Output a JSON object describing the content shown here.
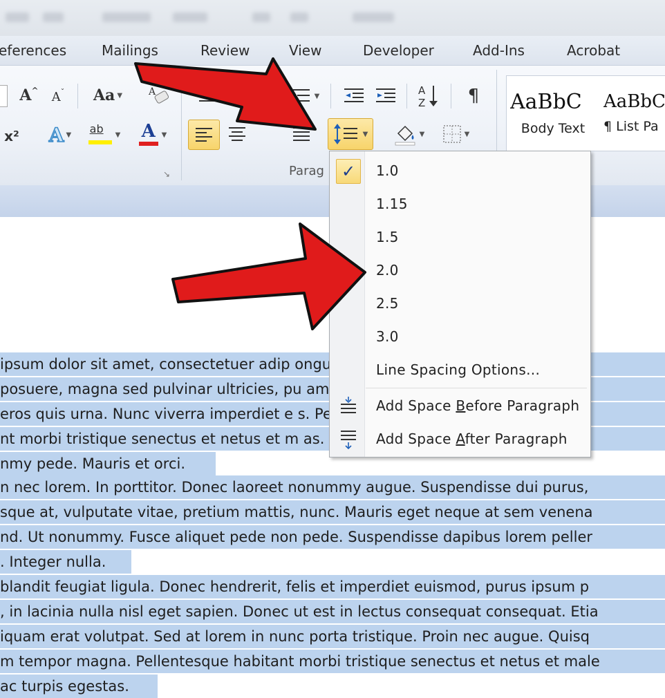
{
  "tabs": [
    "eferences",
    "Mailings",
    "Review",
    "View",
    "Developer",
    "Add-Ins",
    "Acrobat"
  ],
  "ribbon": {
    "font_group": {
      "grow_font": "A",
      "shrink_font": "A",
      "change_case": "Aa",
      "superscript": "x²",
      "text_effects": "A",
      "highlight": "ab",
      "font_color": "A"
    },
    "paragraph_label": "Parag",
    "pilcrow": "¶",
    "sort": "A↓Z",
    "styles": [
      {
        "sample": "AaBbC",
        "name": "Body Text"
      },
      {
        "sample": "AaBbC",
        "name": "¶ List Pa"
      }
    ]
  },
  "menu": {
    "check_mark": "✓",
    "items": [
      {
        "label": "1.0",
        "checked": true
      },
      {
        "label": "1.15"
      },
      {
        "label": "1.5"
      },
      {
        "label": "2.0"
      },
      {
        "label": "2.5"
      },
      {
        "label": "3.0"
      },
      {
        "label": "Line Spacing Options..."
      }
    ],
    "before_pre": "Add Space ",
    "before_key": "B",
    "before_post": "efore Paragraph",
    "after_pre": "Add Space ",
    "after_key": "A",
    "after_post": "fter Paragraph"
  },
  "document": {
    "lines": [
      "ipsum dolor sit amet, consectetuer adip                                                  ongue ma",
      "posuere, magna sed pulvinar ultricies, pu                                                  amet cor",
      "eros quis urna. Nunc viverra imperdiet e                                                  s. Pellent",
      "nt morbi tristique senectus et netus et m                                                  as. Proin p",
      "nmy pede. Mauris et orci.",
      "n nec lorem. In porttitor. Donec laoreet nonummy augue. Suspendisse dui purus,",
      "sque at, vulputate vitae, pretium mattis, nunc. Mauris eget neque at sem venena",
      "nd. Ut nonummy. Fusce aliquet pede non pede. Suspendisse dapibus lorem peller",
      ". Integer nulla.",
      "blandit feugiat ligula. Donec hendrerit, felis et imperdiet euismod, purus ipsum p",
      ", in lacinia nulla nisl eget sapien. Donec ut est in lectus consequat consequat. Etia",
      "iquam erat volutpat. Sed at lorem in nunc porta tristique. Proin nec augue. Quisq",
      "m tempor magna. Pellentesque habitant morbi tristique senectus et netus et malе",
      "ac turpis egestas."
    ]
  },
  "colors": {
    "selection": "#bcd3ee",
    "arrow_red": "#e01b1b",
    "menu_check_bg": "#f8d978"
  }
}
